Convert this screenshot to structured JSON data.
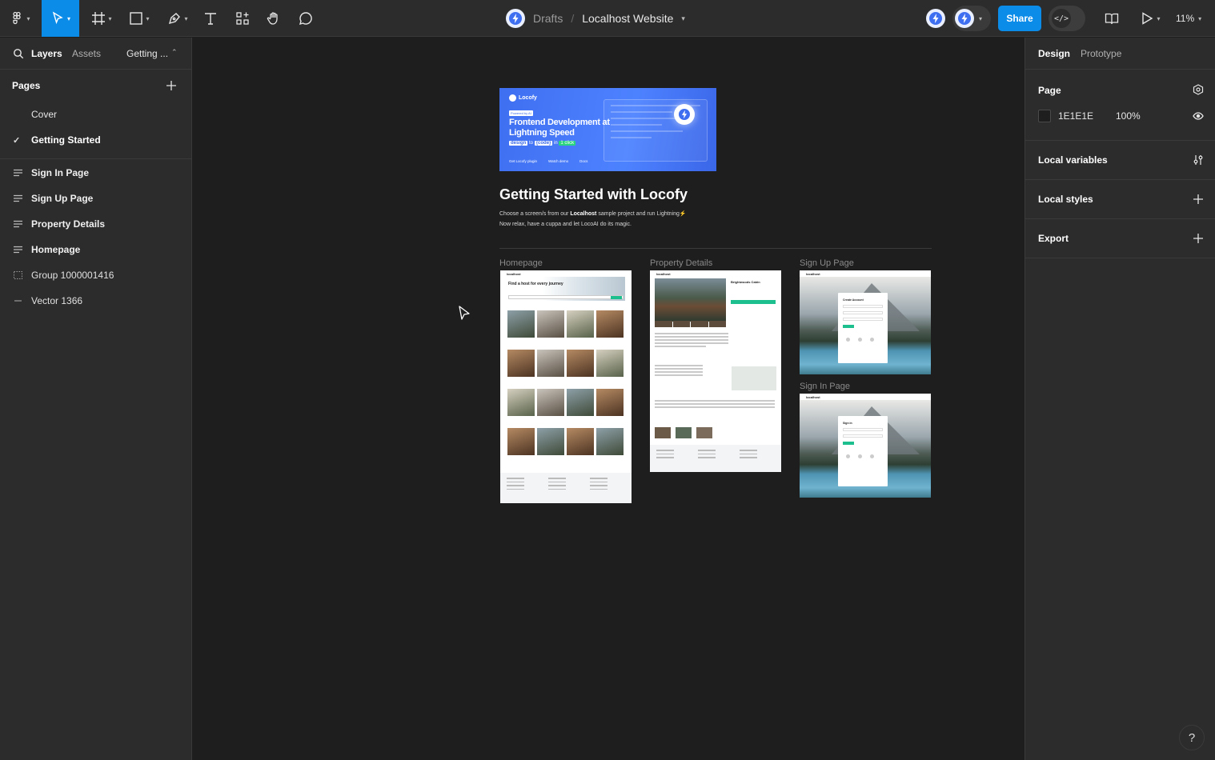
{
  "toolbar": {
    "zoom": "11%",
    "share_label": "Share",
    "devmode_icon": "</>",
    "breadcrumb": {
      "drafts": "Drafts",
      "separator": "/",
      "file": "Localhost Website"
    },
    "icons": [
      "figma-menu-icon",
      "move-tool-icon",
      "frame-tool-icon",
      "shape-tool-icon",
      "pen-tool-icon",
      "text-tool-icon",
      "components-icon",
      "hand-tool-icon",
      "comment-icon",
      "library-icon",
      "play-icon"
    ]
  },
  "left_panel": {
    "tabs": {
      "layers": "Layers",
      "assets": "Assets",
      "current_page": "Getting ..."
    },
    "pages_title": "Pages",
    "pages": [
      {
        "label": "Cover",
        "current": false
      },
      {
        "label": "Getting Started",
        "current": true
      }
    ],
    "layers": [
      {
        "label": "Sign In Page",
        "icon": "frame-lines-icon"
      },
      {
        "label": "Sign Up Page",
        "icon": "frame-lines-icon"
      },
      {
        "label": "Property Details",
        "icon": "frame-lines-icon"
      },
      {
        "label": "Homepage",
        "icon": "frame-lines-icon"
      },
      {
        "label": "Group 1000001416",
        "icon": "group-icon"
      },
      {
        "label": "Vector 1366",
        "icon": "vector-line-icon"
      }
    ]
  },
  "right_panel": {
    "tabs": {
      "design": "Design",
      "prototype": "Prototype"
    },
    "page_section": {
      "title": "Page",
      "color_hex": "1E1E1E",
      "opacity": "100%"
    },
    "local_variables": "Local variables",
    "local_styles": "Local styles",
    "export": "Export"
  },
  "help": "?",
  "canvas": {
    "banner": {
      "brand": "Locofy",
      "tagline": "Powered by AI",
      "headline": "Frontend Development at Lightning Speed",
      "sub_design": "design",
      "sub_to": "to",
      "sub_code": "{code}",
      "sub_in": "in",
      "sub_click": "1 click",
      "links": [
        "Get Locofy plugin",
        "Watch demo",
        "Docs"
      ]
    },
    "title": "Getting Started with Locofy",
    "desc_line1_pre": "Choose a screen/s from our",
    "desc_line1_bold": "Localhost",
    "desc_line1_post": "sample project and run Lightning",
    "desc_line2": "Now relax, have a cuppa and let LocoAI do its magic.",
    "frames": {
      "homepage": {
        "label": "Homepage",
        "logo": "localhost",
        "hero": "Find a host for every journey"
      },
      "property": {
        "label": "Property Details",
        "logo": "localhost",
        "name": "Brightwoods Cabin"
      },
      "signup": {
        "label": "Sign Up Page",
        "logo": "localhost",
        "card_title": "Create Account"
      },
      "signin": {
        "label": "Sign In Page",
        "logo": "localhost",
        "card_title": "Sign in"
      }
    }
  },
  "colors": {
    "accent": "#0c8ce9",
    "panel": "#2c2c2c",
    "canvas": "#1e1e1e",
    "locofy_blue": "#4d82ff",
    "cta_green": "#1dbf8f"
  }
}
